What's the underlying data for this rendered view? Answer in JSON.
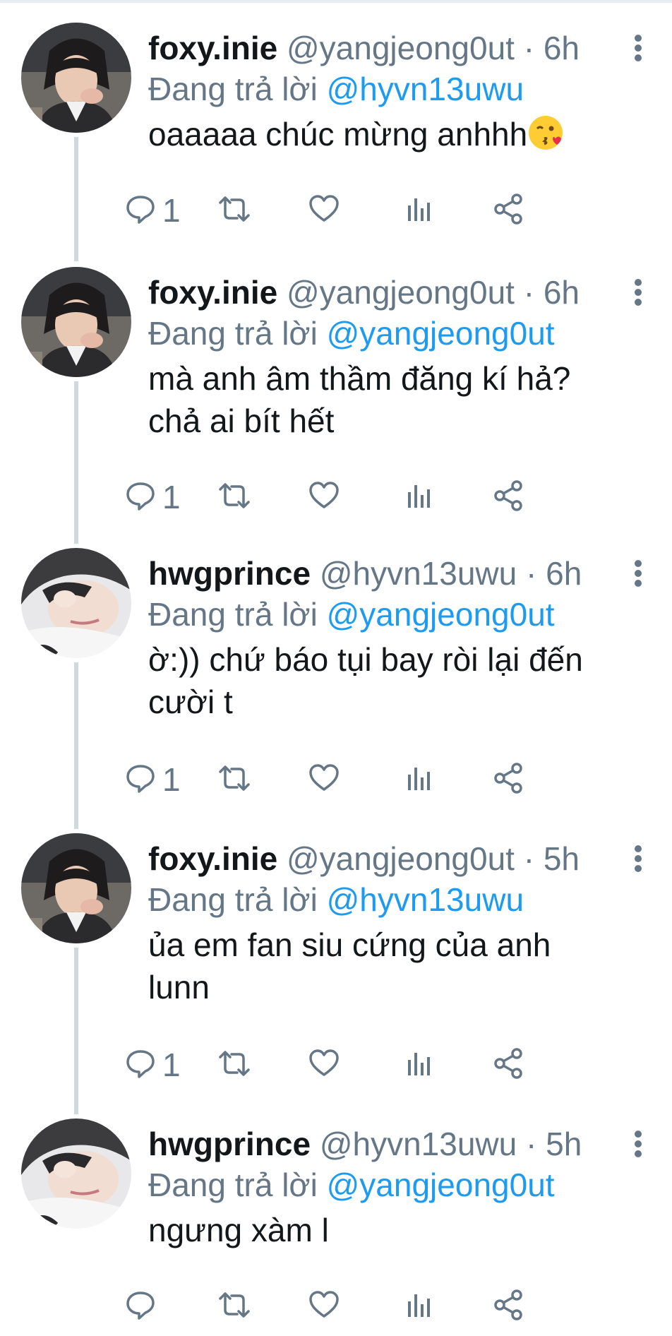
{
  "reply_prefix": "Đang trả lời",
  "tweets": [
    {
      "name": "foxy.inie",
      "handle": "@yangjeong0ut",
      "separator": "·",
      "time": "6h",
      "reply_to": "@hyvn13uwu",
      "text": "oaaaaa chúc mừng anhhh",
      "emoji": "face-blowing-a-kiss",
      "reply_count": "1",
      "avatar": "avatar-foxy",
      "thread_line": true
    },
    {
      "name": "foxy.inie",
      "handle": "@yangjeong0ut",
      "separator": "·",
      "time": "6h",
      "reply_to": "@yangjeong0ut",
      "text": "mà anh âm thầm đăng kí hả?\nchả ai bít hết",
      "reply_count": "1",
      "avatar": "avatar-foxy",
      "thread_line": true
    },
    {
      "name": "hwgprince",
      "handle": "@hyvn13uwu",
      "separator": "·",
      "time": "6h",
      "reply_to": "@yangjeong0ut",
      "text": "ờ:)) chứ báo tụi bay ròi lại đến\ncười t",
      "reply_count": "1",
      "avatar": "avatar-hwg",
      "thread_line": true
    },
    {
      "name": "foxy.inie",
      "handle": "@yangjeong0ut",
      "separator": "·",
      "time": "5h",
      "reply_to": "@hyvn13uwu",
      "text": "ủa em fan siu cứng của anh\nlunn",
      "reply_count": "1",
      "avatar": "avatar-foxy",
      "thread_line": true
    },
    {
      "name": "hwgprince",
      "handle": "@hyvn13uwu",
      "separator": "·",
      "time": "5h",
      "reply_to": "@yangjeong0ut",
      "text": "ngưng xàm l",
      "reply_count": "",
      "avatar": "avatar-hwg",
      "thread_line": false
    }
  ],
  "icons": {
    "reply": "reply-icon",
    "retweet": "retweet-icon",
    "like": "heart-icon",
    "analytics": "analytics-icon",
    "share": "share-icon",
    "more": "more-vertical-icon"
  },
  "colors": {
    "text": "#14171a",
    "secondary": "#657786",
    "mention": "#1d9bf0",
    "thread_line": "#cfd9de",
    "background": "#ffffff"
  }
}
